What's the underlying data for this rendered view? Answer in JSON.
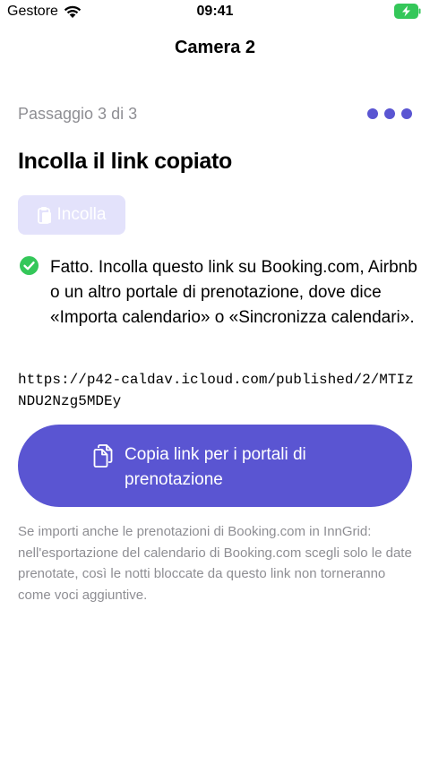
{
  "status_bar": {
    "carrier": "Gestore",
    "time": "09:41",
    "wifi_icon": "wifi-icon",
    "battery_icon": "battery-charging-icon",
    "battery_color": "#34c759"
  },
  "nav": {
    "title": "Camera 2"
  },
  "step": {
    "label": "Passaggio 3 di 3",
    "current": 3,
    "total": 3,
    "dot_color": "#5a55d2"
  },
  "main": {
    "heading": "Incolla il link copiato",
    "paste_button": {
      "label": "Incolla",
      "icon": "clipboard-icon",
      "enabled": false
    },
    "done_message": {
      "icon": "checkmark-circle-icon",
      "icon_color": "#34c759",
      "text": "Fatto. Incolla questo link su Booking.com, Airbnb o un altro portale di prenotazione, dove dice «Importa calendario» o «Sincronizza calendari»."
    },
    "link": "https://p42-caldav.icloud.com/published/2/MTIzNDU2Nzg5MDEy",
    "copy_button": {
      "label": "Copia link per i portali di prenotazione",
      "icon": "copy-documents-icon",
      "color": "#5a55d2"
    },
    "footnote": "Se importi anche le prenotazioni di Booking.com in InnGrid: nell'esportazione del calendario di Booking.com scegli solo le date prenotate, così le notti bloccate da questo link non torneranno come voci aggiuntive."
  }
}
